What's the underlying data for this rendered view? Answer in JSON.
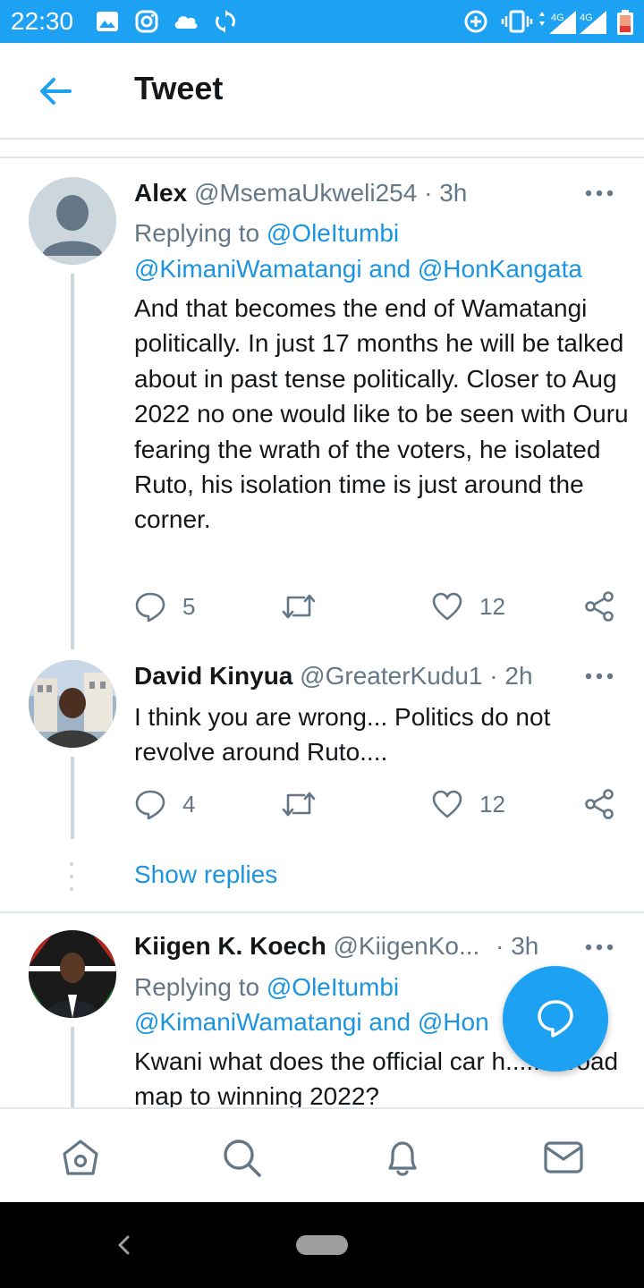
{
  "status_bar": {
    "time": "22:30",
    "icons": [
      "image-icon",
      "instagram-icon",
      "cloud-icon",
      "sync-icon",
      "data-saver-icon",
      "vibrate-icon",
      "signal-4g-icon",
      "signal-4g-icon",
      "battery-icon"
    ],
    "network_labels": [
      "4G",
      "4G"
    ]
  },
  "header": {
    "title": "Tweet"
  },
  "tweets": [
    {
      "name": "Alex",
      "handle": "@MsemaUkweli254",
      "time": "· 3h",
      "replying_label": "Replying to",
      "replying_to_1": "@OleItumbi",
      "replying_to_2": "@KimaniWamatangi",
      "and_label": "and",
      "replying_to_3": "@HonKangata",
      "text": "And that becomes the end of Wamatangi politically. In just 17 months he will be talked about in past tense politically. Closer to Aug 2022 no one would like to be seen with Ouru fearing the wrath of the voters, he isolated Ruto, his isolation time is just around the corner.",
      "replies": "5",
      "likes": "12"
    },
    {
      "name": "David Kinyua",
      "handle": "@GreaterKudu1",
      "time": "· 2h",
      "text": "I think you are wrong... Politics do not revolve around Ruto....",
      "replies": "4",
      "likes": "12"
    },
    {
      "name": "Kiigen K. Koech",
      "handle": "@KiigenKo...",
      "time": "· 3h",
      "replying_label": "Replying to",
      "replying_to_1": "@OleItumbi",
      "replying_to_2": "@KimaniWamatangi",
      "and_label": "and",
      "replying_to_3": "@Hon",
      "text": "Kwani what does the official car h..... A road map to winning 2022?"
    }
  ],
  "show_replies": "Show replies",
  "bottom_nav": [
    "home-icon",
    "search-icon",
    "notifications-icon",
    "messages-icon"
  ],
  "colors": {
    "accent": "#1da1f2",
    "link": "#1b95e0",
    "secondary_text": "#657786",
    "divider": "#e1e8ed"
  }
}
